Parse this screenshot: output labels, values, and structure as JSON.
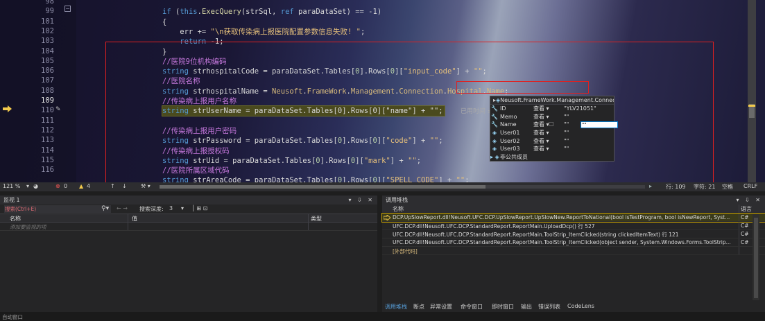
{
  "editor": {
    "line_numbers": [
      "98",
      "99",
      "101",
      "102",
      "103",
      "104",
      "105",
      "106",
      "107",
      "108",
      "109",
      "110",
      "111",
      "112",
      "113",
      "114",
      "115",
      "116"
    ],
    "current_line": "109",
    "lines": [
      [
        {
          "t": "kw",
          "v": "if"
        },
        {
          "t": "",
          "v": " ("
        },
        {
          "t": "kw",
          "v": "this"
        },
        {
          "t": "",
          "v": "."
        },
        {
          "t": "cls",
          "v": "ExecQuery"
        },
        {
          "t": "",
          "v": "(strSql, "
        },
        {
          "t": "kw",
          "v": "ref"
        },
        {
          "t": "",
          "v": " paraDataSet) == -1)"
        }
      ],
      [
        {
          "t": "",
          "v": "{"
        }
      ],
      [
        {
          "t": "",
          "v": "    err += "
        },
        {
          "t": "str",
          "v": "\"\\n获取传染病上报医院配置参数信息失败! \""
        },
        {
          "t": "",
          "v": ";"
        }
      ],
      [
        {
          "t": "",
          "v": "    "
        },
        {
          "t": "kw",
          "v": "return"
        },
        {
          "t": "",
          "v": " -1;"
        }
      ],
      [
        {
          "t": "",
          "v": "}"
        }
      ],
      [
        {
          "t": "cm",
          "v": "//医院9位机构编码"
        }
      ],
      [
        {
          "t": "kw",
          "v": "string"
        },
        {
          "t": "",
          "v": " strhospitalCode = paraDataSet.Tables["
        },
        {
          "t": "num",
          "v": "0"
        },
        {
          "t": "",
          "v": "].Rows["
        },
        {
          "t": "num",
          "v": "0"
        },
        {
          "t": "",
          "v": "]["
        },
        {
          "t": "str",
          "v": "\"input_code\""
        },
        {
          "t": "",
          "v": "] + "
        },
        {
          "t": "str",
          "v": "\"\""
        },
        {
          "t": "",
          "v": ";"
        }
      ],
      [
        {
          "t": "cm",
          "v": "//医院名称"
        }
      ],
      [
        {
          "t": "kw",
          "v": "string"
        },
        {
          "t": "",
          "v": " strhospitalName = "
        },
        {
          "t": "mem",
          "v": "Neusoft"
        },
        {
          "t": "",
          "v": "."
        },
        {
          "t": "mem",
          "v": "FrameWork"
        },
        {
          "t": "",
          "v": "."
        },
        {
          "t": "mem",
          "v": "Management"
        },
        {
          "t": "",
          "v": "."
        },
        {
          "t": "mem",
          "v": "Connection"
        },
        {
          "t": "",
          "v": "."
        },
        {
          "t": "mem",
          "v": "Hospital"
        },
        {
          "t": "",
          "v": "."
        },
        {
          "t": "mem",
          "v": "Name"
        },
        {
          "t": "",
          "v": ";"
        }
      ],
      [
        {
          "t": "cm",
          "v": "//传染病上报用户名称"
        }
      ],
      [
        {
          "t": "kw",
          "v": "string"
        },
        {
          "t": "",
          "v": " strUserName = paraDataSet.Tables[0].Rows[0][\"name\"] + \"\";"
        }
      ],
      [
        {
          "t": "",
          "v": ""
        }
      ],
      [
        {
          "t": "cm",
          "v": "//传染病上报用户密码"
        }
      ],
      [
        {
          "t": "kw",
          "v": "string"
        },
        {
          "t": "",
          "v": " strPassword = paraDataSet.Tables["
        },
        {
          "t": "num",
          "v": "0"
        },
        {
          "t": "",
          "v": "].Rows["
        },
        {
          "t": "num",
          "v": "0"
        },
        {
          "t": "",
          "v": "]["
        },
        {
          "t": "str",
          "v": "\"code\""
        },
        {
          "t": "",
          "v": "] + "
        },
        {
          "t": "str",
          "v": "\"\""
        },
        {
          "t": "",
          "v": ";"
        }
      ],
      [
        {
          "t": "cm",
          "v": "//传染病上报授权码"
        }
      ],
      [
        {
          "t": "kw",
          "v": "string"
        },
        {
          "t": "",
          "v": " strUid = paraDataSet.Tables["
        },
        {
          "t": "num",
          "v": "0"
        },
        {
          "t": "",
          "v": "].Rows["
        },
        {
          "t": "num",
          "v": "0"
        },
        {
          "t": "",
          "v": "]["
        },
        {
          "t": "str",
          "v": "\"mark\""
        },
        {
          "t": "",
          "v": "] + "
        },
        {
          "t": "str",
          "v": "\"\""
        },
        {
          "t": "",
          "v": ";"
        }
      ],
      [
        {
          "t": "cm",
          "v": "//医院所属区域代码"
        }
      ],
      [
        {
          "t": "kw",
          "v": "string"
        },
        {
          "t": "",
          "v": " strAreaCode = paraDataSet.Tables["
        },
        {
          "t": "num",
          "v": "0"
        },
        {
          "t": "",
          "v": "].Rows["
        },
        {
          "t": "num",
          "v": "0"
        },
        {
          "t": "",
          "v": "]["
        },
        {
          "t": "str",
          "v": "\"SPELL_CODE\""
        },
        {
          "t": "",
          "v": "] + "
        },
        {
          "t": "str",
          "v": "\"\""
        },
        {
          "t": "",
          "v": ";"
        }
      ]
    ],
    "elapsed_label": "已用时间 ≤"
  },
  "datatip": {
    "header": "Neusoft.FrameWork.Management.Connection.Hospital",
    "header_btns": "{} -□",
    "rows": [
      {
        "icon": "wrench-icon",
        "glyph": "🔧",
        "name": "ID",
        "look": "查看 ▾",
        "value": "\"YLV21051\""
      },
      {
        "icon": "wrench-icon",
        "glyph": "🔧",
        "name": "Memo",
        "look": "查看 ▾",
        "value": "\"\""
      },
      {
        "icon": "wrench-icon",
        "glyph": "🔧",
        "name": "Name",
        "look": "查看 ▾",
        "value": "\"\""
      },
      {
        "icon": "field-icon",
        "glyph": "◈",
        "name": "User01",
        "look": "查看 ▾",
        "value": "\"\""
      },
      {
        "icon": "field-icon",
        "glyph": "◈",
        "name": "User02",
        "look": "查看 ▾",
        "value": "\"\""
      },
      {
        "icon": "field-icon",
        "glyph": "◈",
        "name": "User03",
        "look": "查看 ▾",
        "value": "\"\""
      },
      {
        "icon": "expand-icon",
        "glyph": "▸ ◈",
        "name": "非公共成员",
        "look": "",
        "value": ""
      }
    ],
    "name_input_value": "\"\""
  },
  "status": {
    "zoom": "121 %",
    "errors": "0",
    "warnings": "4",
    "line": "行: 109",
    "char": "字符: 21",
    "space": "空格",
    "eol": "CRLF"
  },
  "watch": {
    "title": "监视 1",
    "search_placeholder": "搜索(Ctrl+E)",
    "depth_label": "搜索深度:",
    "depth_value": "3",
    "col_name": "名称",
    "col_value": "值",
    "col_type": "类型",
    "add_placeholder": "添加要监视的项"
  },
  "callstack": {
    "title": "调用堆栈",
    "col_name": "名称",
    "col_lang": "语言",
    "frames": [
      {
        "text": "DCP.UpSlowReport.dll!Neusoft.UFC.DCP.UpSlowReport.UpSlowNew.ReportToNational(bool isTestProgram, bool isNewReport, Syst...",
        "lang": "C#",
        "current": true
      },
      {
        "text": "UFC.DCP.dll!Neusoft.UFC.DCP.StandardReport.ReportMain.UploadDcp() 行 527",
        "lang": "C#",
        "current": false
      },
      {
        "text": "UFC.DCP.dll!Neusoft.UFC.DCP.StandardReport.ReportMain.ToolStrip_ItemClicked(string clickedItemText) 行 121",
        "lang": "C#",
        "current": false
      },
      {
        "text": "UFC.DCP.dll!Neusoft.UFC.DCP.StandardReport.ReportMain.ToolStrip_ItemClicked(object sender, System.Windows.Forms.ToolStrip...",
        "lang": "C#",
        "current": false
      },
      {
        "text": "[外部代码]",
        "lang": "",
        "current": false
      }
    ],
    "tabs": [
      "调用堆栈",
      "断点",
      "异常设置",
      "命令窗口",
      "即时窗口",
      "输出",
      "错误列表",
      "CodeLens"
    ]
  },
  "bottom": {
    "label": "自动窗口"
  }
}
